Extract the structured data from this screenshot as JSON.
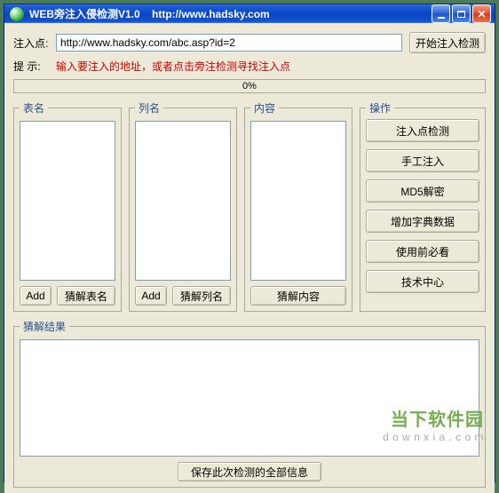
{
  "window": {
    "title": "WEB旁注入侵检测V1.0    http://www.hadsky.com",
    "min_tooltip": "最小化",
    "max_tooltip": "最大化",
    "close_tooltip": "关闭"
  },
  "top": {
    "inject_label": "注入点:",
    "url_value": "http://www.hadsky.com/abc.asp?id=2",
    "start_btn": "开始注入检测",
    "hint_label": "提 示:",
    "hint_text": "输入要注入的地址，或者点击旁注检测寻找注入点",
    "progress_text": "0%"
  },
  "groups": {
    "table_legend": "表名",
    "cols_legend": "列名",
    "content_legend": "内容",
    "ops_legend": "操作",
    "result_legend": "猜解结果",
    "add_btn": "Add",
    "guess_table_btn": "猜解表名",
    "guess_cols_btn": "猜解列名",
    "guess_content_btn": "猜解内容"
  },
  "ops": [
    "注入点检测",
    "手工注入",
    "MD5解密",
    "增加字典数据",
    "使用前必看",
    "技术中心"
  ],
  "bottom": {
    "save_btn": "保存此次检测的全部信息"
  },
  "watermark": {
    "main": "当下软件园",
    "sub": "d o w n x i a . c o m"
  }
}
